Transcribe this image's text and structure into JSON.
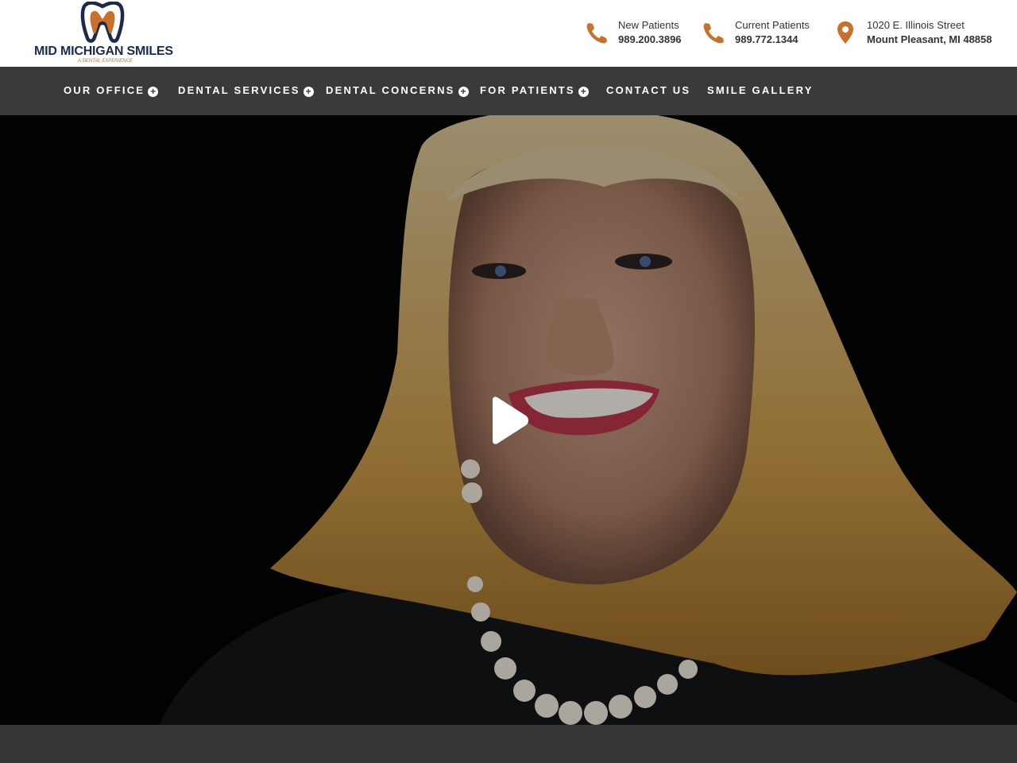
{
  "brand": {
    "name": "MID MICHIGAN SMILES",
    "tagline": "A DENTAL EXPERIENCE",
    "colors": {
      "navy": "#1b2a4a",
      "orange": "#c8702c",
      "nav_bg": "#3a3a3a"
    }
  },
  "header": {
    "contacts": [
      {
        "icon": "phone-icon",
        "label": "New Patients",
        "value": "989.200.3896"
      },
      {
        "icon": "phone-icon",
        "label": "Current Patients",
        "value": "989.772.1344"
      },
      {
        "icon": "map-pin-icon",
        "label": "1020 E. Illinois Street",
        "value": "Mount Pleasant, MI 48858"
      }
    ]
  },
  "nav": {
    "items": [
      {
        "label": "OUR OFFICE",
        "has_submenu": true
      },
      {
        "label": "DENTAL SERVICES",
        "has_submenu": true
      },
      {
        "label": "DENTAL CONCERNS",
        "has_submenu": true
      },
      {
        "label": "FOR PATIENTS",
        "has_submenu": true
      },
      {
        "label": "CONTACT US",
        "has_submenu": false
      },
      {
        "label": "SMILE GALLERY",
        "has_submenu": false
      }
    ]
  },
  "hero": {
    "media": "video",
    "play_icon": "play-icon"
  }
}
